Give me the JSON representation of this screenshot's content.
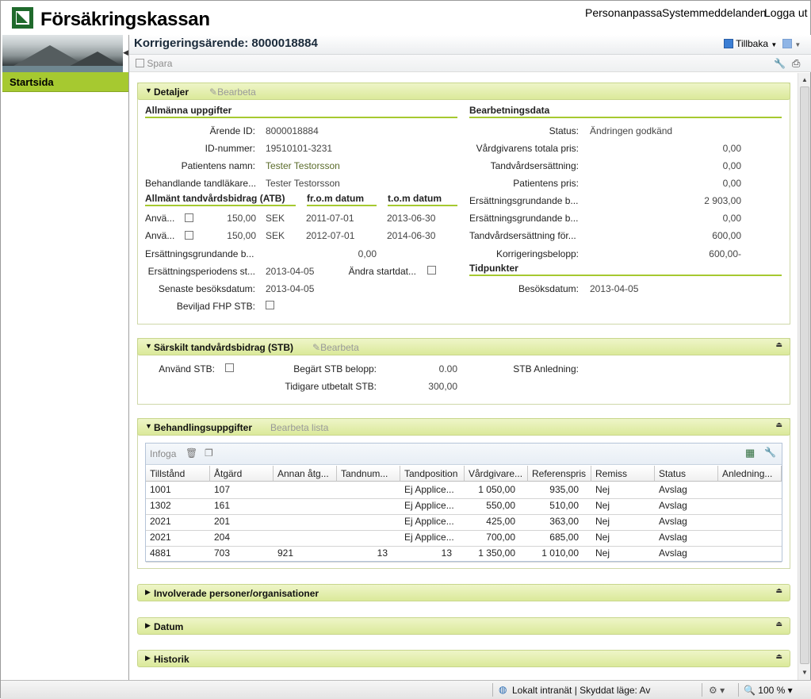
{
  "header": {
    "brand": "Försäkringskassan",
    "links": [
      "Personanpassa",
      "Systemmeddelanden",
      "Logga ut"
    ]
  },
  "sidebar": {
    "start": "Startsida"
  },
  "page": {
    "title": "Korrigeringsärende: 8000018884",
    "back": "Tillbaka",
    "save": "Spara"
  },
  "details": {
    "title": "Detaljer",
    "edit": "Bearbeta",
    "general_head": "Allmänna uppgifter",
    "processing_head": "Bearbetningsdata",
    "fields": [
      {
        "label": "Ärende ID:",
        "value": "8000018884"
      },
      {
        "label": "ID-nummer:",
        "value": "19510101-3231"
      },
      {
        "label": "Patientens namn:",
        "value": "Tester Testorsson"
      },
      {
        "label": "Behandlande tandläkare...",
        "value": "Tester Testorsson"
      }
    ],
    "atb": {
      "head": "Allmänt tandvårdsbidrag (ATB)",
      "from_head": "fr.o.m datum",
      "to_head": "t.o.m datum",
      "rows": [
        {
          "label": "Anvä...",
          "amount": "150,00",
          "currency": "SEK",
          "from": "2011-07-01",
          "to": "2013-06-30"
        },
        {
          "label": "Anvä...",
          "amount": "150,00",
          "currency": "SEK",
          "from": "2012-07-01",
          "to": "2014-06-30"
        }
      ]
    },
    "extra": {
      "base_label": "Ersättningsgrundande b...",
      "base_value": "0,00",
      "period_label": "Ersättningsperiodens st...",
      "period_value": "2013-04-05",
      "change_label": "Ändra startdat...",
      "last_visit_label": "Senaste besöksdatum:",
      "last_visit_value": "2013-04-05",
      "fhp_label": "Beviljad FHP STB:"
    },
    "processing": [
      {
        "label": "Status:",
        "value": "Ändringen godkänd"
      },
      {
        "label": "Vårdgivarens totala pris:",
        "value": "0,00"
      },
      {
        "label": "Tandvårdsersättning:",
        "value": "0,00"
      },
      {
        "label": "Patientens pris:",
        "value": "0,00"
      },
      {
        "label": "Ersättningsgrundande b...",
        "value": "2 903,00"
      },
      {
        "label": "Ersättningsgrundande b...",
        "value": "0,00"
      },
      {
        "label": "Tandvårdsersättning för...",
        "value": "600,00"
      },
      {
        "label": "Korrigeringsbelopp:",
        "value": "600,00-"
      }
    ],
    "time_head": "Tidpunkter",
    "visit_label": "Besöksdatum:",
    "visit_value": "2013-04-05"
  },
  "stb": {
    "title": "Särskilt tandvårdsbidrag (STB)",
    "edit": "Bearbeta",
    "use_label": "Använd STB:",
    "requested_label": "Begärt STB belopp:",
    "requested_value": "0.00",
    "reason_label": "STB Anledning:",
    "paid_label": "Tidigare utbetalt STB:",
    "paid_value": "300,00"
  },
  "treatments": {
    "title": "Behandlingsuppgifter",
    "edit": "Bearbeta lista",
    "insert": "Infoga",
    "columns": [
      "Tillstånd",
      "Åtgärd",
      "Annan åtg...",
      "Tandnum...",
      "Tandposition",
      "Vårdgivare...",
      "Referenspris",
      "Remiss",
      "Status",
      "Anledning..."
    ],
    "rows": [
      [
        "1001",
        "107",
        "",
        "",
        "Ej Applice...",
        "1 050,00",
        "935,00",
        "Nej",
        "Avslag",
        ""
      ],
      [
        "1302",
        "161",
        "",
        "",
        "Ej Applice...",
        "550,00",
        "510,00",
        "Nej",
        "Avslag",
        ""
      ],
      [
        "2021",
        "201",
        "",
        "",
        "Ej Applice...",
        "425,00",
        "363,00",
        "Nej",
        "Avslag",
        ""
      ],
      [
        "2021",
        "204",
        "",
        "",
        "Ej Applice...",
        "700,00",
        "685,00",
        "Nej",
        "Avslag",
        ""
      ],
      [
        "4881",
        "703",
        "921",
        "13",
        "13",
        "1 350,00",
        "1 010,00",
        "Nej",
        "Avslag",
        ""
      ]
    ]
  },
  "collapsed_sections": [
    "Involverade personer/organisationer",
    "Datum",
    "Historik"
  ],
  "statusbar": {
    "zone": "Lokalt intranät | Skyddat läge: Av",
    "zoom": "100 %"
  }
}
